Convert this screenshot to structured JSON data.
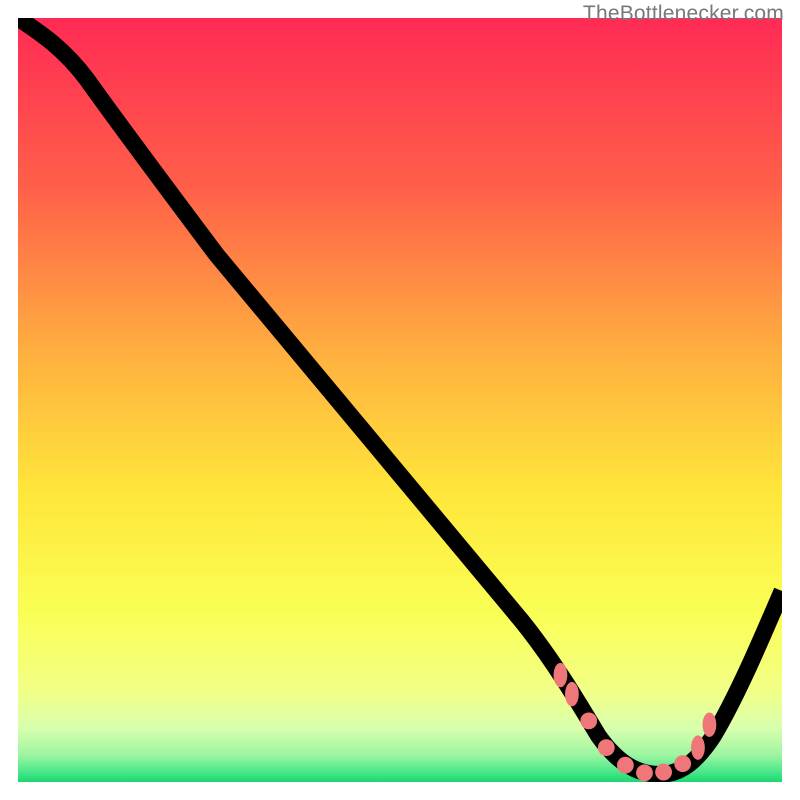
{
  "attribution": "TheBottlenecker.com",
  "colors": {
    "gradient_top": "#ff2a55",
    "gradient_q1": "#ff6b4a",
    "gradient_mid": "#ffd23a",
    "gradient_q3": "#f6ff70",
    "gradient_near_bottom": "#d8ffb0",
    "gradient_bottom": "#22e27a",
    "curve": "#000000",
    "dots": "#ef777a",
    "attribution_text": "#777777"
  },
  "chart_data": {
    "type": "line",
    "title": "",
    "xlabel": "",
    "ylabel": "",
    "xlim": [
      0,
      100
    ],
    "ylim": [
      0,
      100
    ],
    "series": [
      {
        "name": "bottleneck-curve",
        "x": [
          0,
          6,
          12,
          18,
          24,
          30,
          36,
          42,
          48,
          54,
          60,
          66,
          70,
          74,
          78,
          82,
          86,
          90,
          94,
          100
        ],
        "y": [
          100,
          97,
          92,
          85,
          77,
          69,
          61,
          53,
          45,
          37,
          29,
          21,
          14,
          8,
          3,
          1,
          1,
          3,
          9,
          25
        ]
      }
    ],
    "highlight_points": {
      "name": "optimal-zone-dots",
      "x": [
        71,
        72.5,
        74.5,
        77,
        79.5,
        82,
        84.5,
        87,
        89,
        90.5
      ],
      "y": [
        11,
        9,
        6,
        3.5,
        1.8,
        1.2,
        1.3,
        2.2,
        4,
        6.5
      ]
    }
  }
}
